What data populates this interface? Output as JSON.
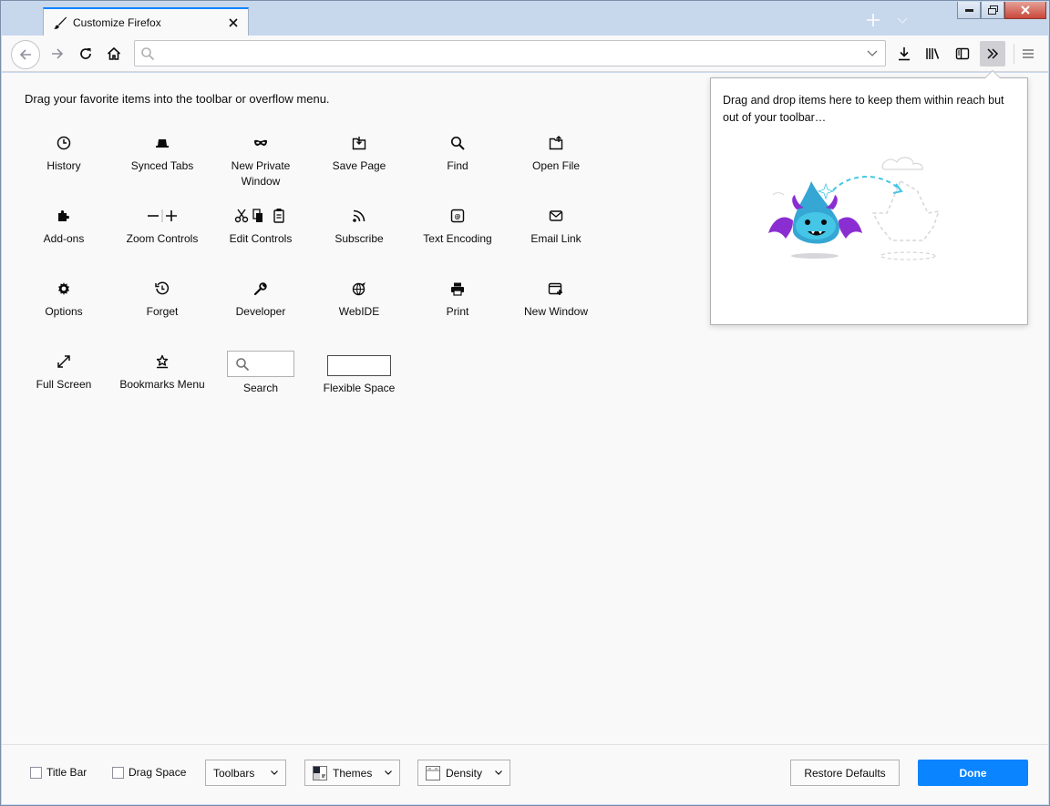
{
  "window": {
    "tab_title": "Customize Firefox"
  },
  "navbar": {
    "url_value": "",
    "url_placeholder": ""
  },
  "palette": {
    "header": "Drag your favorite items into the toolbar or overflow menu.",
    "items": [
      {
        "label": "History",
        "icon": "clock-icon"
      },
      {
        "label": "Synced Tabs",
        "icon": "synced-tabs-icon"
      },
      {
        "label": "New Private Window",
        "icon": "mask-icon"
      },
      {
        "label": "Save Page",
        "icon": "save-page-icon"
      },
      {
        "label": "Find",
        "icon": "magnifier-icon"
      },
      {
        "label": "Open File",
        "icon": "open-file-icon"
      },
      {
        "label": "Add-ons",
        "icon": "puzzle-icon"
      },
      {
        "label": "Zoom Controls",
        "icon": "zoom-icon"
      },
      {
        "label": "Edit Controls",
        "icon": "edit-icon"
      },
      {
        "label": "Subscribe",
        "icon": "feed-icon"
      },
      {
        "label": "Text Encoding",
        "icon": "encoding-icon"
      },
      {
        "label": "Email Link",
        "icon": "envelope-icon"
      },
      {
        "label": "Options",
        "icon": "gear-icon"
      },
      {
        "label": "Forget",
        "icon": "forget-icon"
      },
      {
        "label": "Developer",
        "icon": "wrench-icon"
      },
      {
        "label": "WebIDE",
        "icon": "globe-icon"
      },
      {
        "label": "Print",
        "icon": "printer-icon"
      },
      {
        "label": "New Window",
        "icon": "new-window-icon"
      },
      {
        "label": "Full Screen",
        "icon": "fullscreen-icon"
      },
      {
        "label": "Bookmarks Menu",
        "icon": "bookmark-star-icon"
      },
      {
        "label": "Search",
        "icon": "search-widget-icon"
      },
      {
        "label": "Flexible Space",
        "icon": "flexible-space-icon"
      }
    ]
  },
  "overflow_panel": {
    "text": "Drag and drop items here to keep them within reach but out of your toolbar…"
  },
  "footer": {
    "title_bar": "Title Bar",
    "drag_space": "Drag Space",
    "toolbars": "Toolbars",
    "themes": "Themes",
    "density": "Density",
    "restore": "Restore Defaults",
    "done": "Done"
  },
  "colors": {
    "accent": "#0a84ff",
    "panel_bg": "#f9f9fa",
    "dragon_blue": "#36a6d4",
    "dragon_purple": "#8a2ed1"
  }
}
